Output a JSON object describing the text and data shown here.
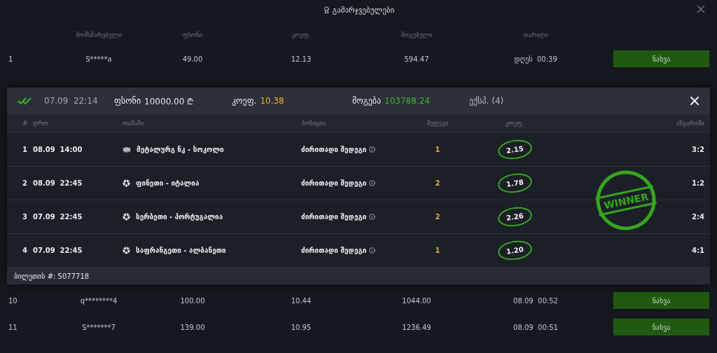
{
  "title": "გამარჯვებულები",
  "columns": [
    "მომხმარებელი",
    "ფსონი",
    "კოეფ.",
    "მოგებული",
    "თარიღი"
  ],
  "top_rows": [
    {
      "rank": "1",
      "user": "S*****a",
      "stake": "49.00",
      "coef": "12.13",
      "won": "594.47",
      "date": "დღეს  00:39",
      "action": "ნახვა"
    }
  ],
  "bottom_rows": [
    {
      "rank": "10",
      "user": "q********4",
      "stake": "100.00",
      "coef": "10.44",
      "won": "1044.00",
      "date": "08.09  00:52",
      "action": "ნახვა"
    },
    {
      "rank": "11",
      "user": "S*******7",
      "stake": "139.00",
      "coef": "10.95",
      "won": "1236.49",
      "date": "08.09  00:51",
      "action": "ნახვა"
    }
  ],
  "ticket": {
    "datetime": "07.09  22:14",
    "stake_label": "ფსონი",
    "stake": "10000.00 ₾",
    "coef_label": "კოეფ.",
    "coef": "10.38",
    "win_label": "მოგება",
    "win": "103788.24",
    "type": "ექსპ. (4)",
    "columns": [
      "#",
      "დრო",
      "თამაში",
      "პოზიცია",
      "შედეგი",
      "კოეფ.",
      "ანგარიში"
    ],
    "events": [
      {
        "index": "1",
        "datetime": "08.09  14:00",
        "kind": "hockey",
        "match": "მეტალურგ ნკ - სოკოლი",
        "position": "ძირითადი შედეგი",
        "result": "1",
        "coef": "2.15",
        "score": "3:2"
      },
      {
        "index": "2",
        "datetime": "08.09  22:45",
        "kind": "soccer",
        "match": "ფინეთი - იტალია",
        "position": "ძირითადი შედეგი",
        "result": "2",
        "coef": "1.78",
        "score": "1:2"
      },
      {
        "index": "3",
        "datetime": "07.09  22:45",
        "kind": "soccer",
        "match": "სერბეთი - პორტუგალია",
        "position": "ძირითადი შედეგი",
        "result": "2",
        "coef": "2.26",
        "score": "2:4"
      },
      {
        "index": "4",
        "datetime": "07.09  22:45",
        "kind": "soccer",
        "match": "საფრანგეთი - ალბანეთი",
        "position": "ძირითადი შედეგი",
        "result": "1",
        "coef": "1.20",
        "score": "4:1"
      }
    ],
    "ticket_label": "ბილეთის #: 5077718",
    "stamp": "WINNER"
  }
}
